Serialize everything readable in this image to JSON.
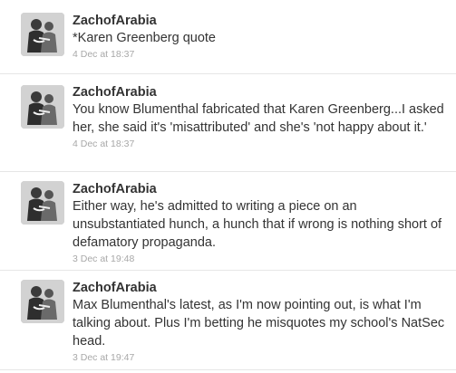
{
  "tweets": [
    {
      "author": "ZachofArabia",
      "text": "*Karen Greenberg quote",
      "time": "4 Dec at 18:37"
    },
    {
      "author": "ZachofArabia",
      "text": "You know Blumenthal fabricated that Karen Greenberg...I asked her, she said it's 'misattributed' and she's 'not happy about it.'",
      "time": "4 Dec at 18:37"
    },
    {
      "author": "ZachofArabia",
      "text": "Either way, he's admitted to writing a piece on an unsubstantiated hunch, a hunch that if wrong is nothing short of defamatory propaganda.",
      "time": "3 Dec at 19:48"
    },
    {
      "author": "ZachofArabia",
      "text": "Max Blumenthal's latest, as I'm now pointing out, is what I'm talking about. Plus I'm betting he misquotes my school's NatSec head.",
      "time": "3 Dec at 19:47"
    }
  ]
}
